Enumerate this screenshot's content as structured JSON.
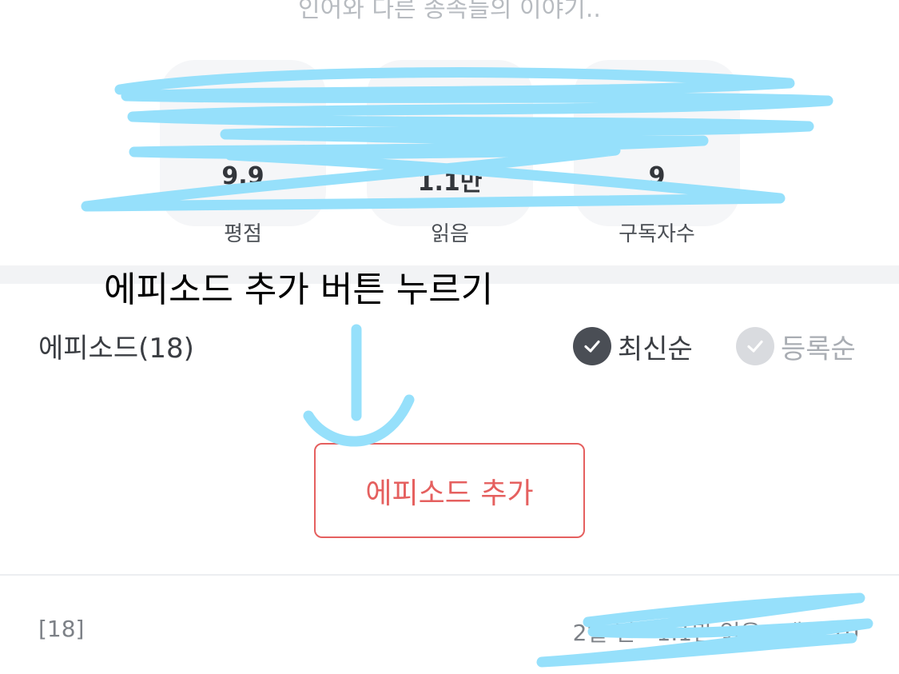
{
  "header": {
    "subtitle": "인어와 다른 종족들의 이야기.."
  },
  "stats": [
    {
      "value": "9.9",
      "label": "평점"
    },
    {
      "value": "1.1만",
      "label": "읽음"
    },
    {
      "value": "9",
      "label": "구독자수"
    }
  ],
  "annotation": {
    "text": "에피소드 추가 버튼 누르기"
  },
  "episodes": {
    "title": "에피소드(18)",
    "sort_options": [
      {
        "label": "최신순",
        "selected": true
      },
      {
        "label": "등록순",
        "selected": false
      }
    ],
    "add_button_label": "에피소드 추가",
    "list": [
      {
        "number": "[18]",
        "meta": "2일 전 · 1.1만 읽음 · 댓글 10"
      }
    ]
  },
  "colors": {
    "accent": "#e5605f",
    "check_selected": "#4a4e55",
    "check_unselected": "#d9dbdf",
    "scribble": "#96e0fb"
  }
}
